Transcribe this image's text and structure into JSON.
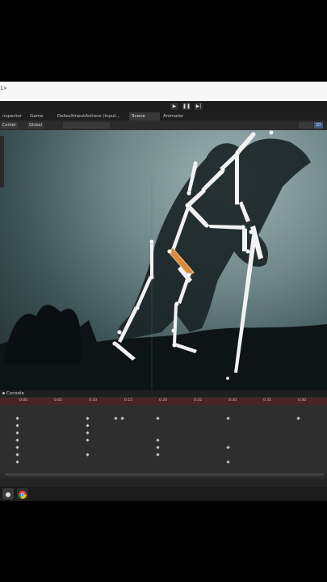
{
  "address_bar": {
    "text": "1>"
  },
  "playbar": {
    "play": "▶",
    "pause": "❚❚",
    "step": "▶|"
  },
  "tabs": [
    {
      "label": "nspector",
      "active": false
    },
    {
      "label": "Game",
      "active": false
    },
    {
      "label": "DefaultInputActions (Input…",
      "active": false
    },
    {
      "label": "Scene",
      "active": true
    },
    {
      "label": "Animator",
      "active": false
    }
  ],
  "scene_toolbar": {
    "pivot": "Center",
    "space": "Global",
    "mode_2d": "2D"
  },
  "console": {
    "title": "Console"
  },
  "timeline": {
    "ticks": [
      "0:00",
      "0:05",
      "0:10",
      "0:15",
      "0:20",
      "0:25",
      "0:30",
      "0:35",
      "0:40"
    ]
  },
  "taskbar": {
    "text": "…"
  }
}
